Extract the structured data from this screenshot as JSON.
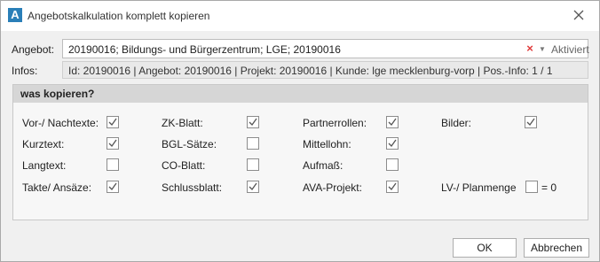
{
  "window": {
    "app_icon_letter": "A",
    "title": "Angebotskalkulation komplett kopieren"
  },
  "form": {
    "angebot_label": "Angebot:",
    "angebot_value": "20190016; Bildungs- und Bürgerzentrum; LGE; 20190016",
    "clear_glyph": "×",
    "dropdown_glyph": "▼",
    "angebot_status": "Aktiviert",
    "infos_label": "Infos:",
    "infos_value": "Id: 20190016 | Angebot: 20190016 | Projekt: 20190016 | Kunde: lge mecklenburg-vorp | Pos.-Info: 1 / 1"
  },
  "group": {
    "title": "was kopieren?",
    "items": [
      {
        "label": "Vor-/ Nachtexte:",
        "checked": true
      },
      {
        "label": "ZK-Blatt:",
        "checked": true
      },
      {
        "label": "Partnerrollen:",
        "checked": true
      },
      {
        "label": "Bilder:",
        "checked": true
      },
      {
        "label": "Kurztext:",
        "checked": true
      },
      {
        "label": "BGL-Sätze:",
        "checked": false
      },
      {
        "label": "Mittellohn:",
        "checked": true
      },
      {
        "label": "Langtext:",
        "checked": false
      },
      {
        "label": "CO-Blatt:",
        "checked": false
      },
      {
        "label": "Aufmaß:",
        "checked": false
      },
      {
        "label": "Takte/ Ansäze:",
        "checked": true
      },
      {
        "label": "Schlussblatt:",
        "checked": true
      },
      {
        "label": "AVA-Projekt:",
        "checked": true
      },
      {
        "label": "LV-/ Planmenge",
        "checked": false
      }
    ],
    "planmenge_suffix": "= 0"
  },
  "buttons": {
    "ok": "OK",
    "cancel": "Abbrechen"
  },
  "colors": {
    "app_icon": "#2a7fb8",
    "clear_x": "#e03a3a",
    "group_header": "#d6d6d6",
    "dialog_bg": "#f0f0f0"
  },
  "icons": {
    "app": "app-icon",
    "close": "close-icon",
    "clear": "clear-icon",
    "dropdown": "chevron-down-icon",
    "check": "check-icon"
  }
}
